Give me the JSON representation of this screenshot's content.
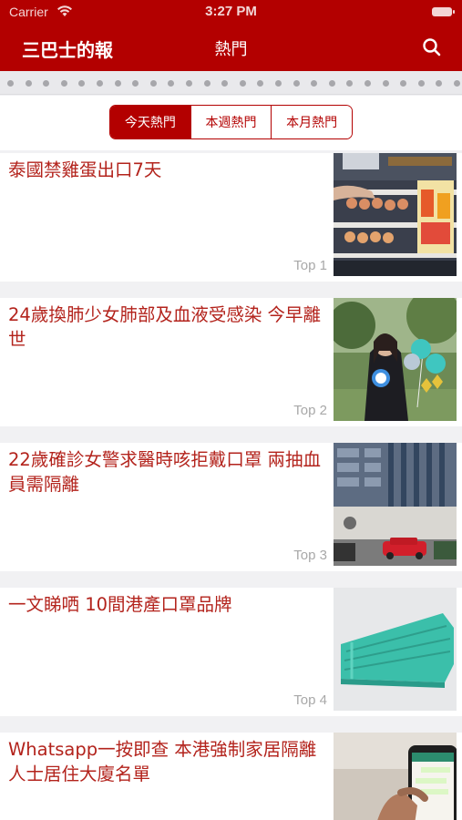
{
  "status_bar": {
    "carrier": "Carrier",
    "time": "3:27 PM"
  },
  "header": {
    "logo": "三巴士的報",
    "title": "熱門"
  },
  "tabs": [
    {
      "label": "今天熱門",
      "active": true
    },
    {
      "label": "本週熱門",
      "active": false
    },
    {
      "label": "本月熱門",
      "active": false
    }
  ],
  "articles": [
    {
      "title": "泰國禁雞蛋出口7天",
      "rank": "Top 1",
      "thumb": "supermarket-egg-shelves"
    },
    {
      "title": "24歲換肺少女肺部及血液受感染 今早離世",
      "rank": "Top 2",
      "thumb": "graduate-with-balloons"
    },
    {
      "title": "22歲確診女警求醫時咳拒戴口罩 兩抽血員需隔離",
      "rank": "Top 3",
      "thumb": "police-building-taxi"
    },
    {
      "title": "一文睇哂 10間港產口罩品牌",
      "rank": "Top 4",
      "thumb": "surgical-masks"
    },
    {
      "title": "Whatsapp一按即查 本港強制家居隔離人士居住大廈名單",
      "rank": "",
      "thumb": "phone-whatsapp"
    }
  ],
  "colors": {
    "brand": "#b30000",
    "title_text": "#b3231c",
    "rank_text": "#a8a8a8"
  }
}
